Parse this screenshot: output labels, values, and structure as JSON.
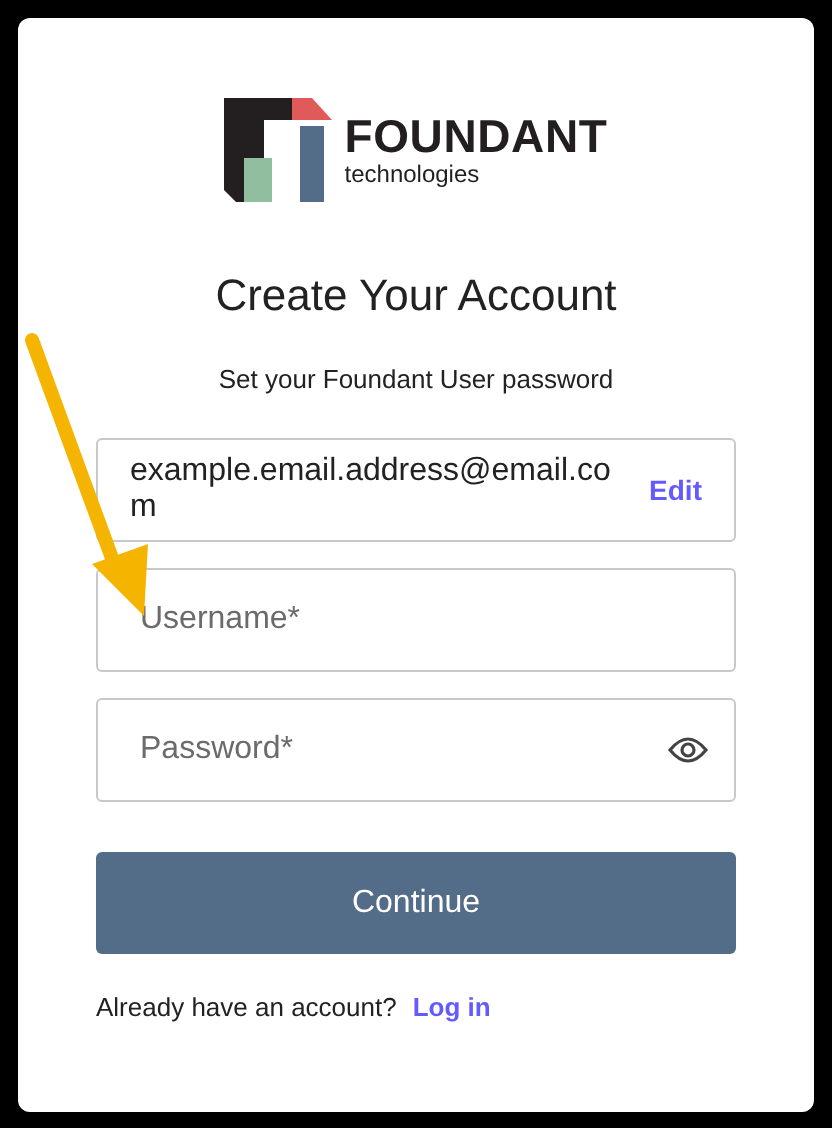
{
  "logo": {
    "name": "FOUNDANT",
    "tagline": "technologies"
  },
  "title": "Create Your Account",
  "subtitle": "Set your Foundant User password",
  "email": {
    "value": "example.email.address@email.com",
    "action": "Edit"
  },
  "fields": [
    {
      "kind": "text",
      "placeholder": "Username*"
    },
    {
      "kind": "password",
      "placeholder": "Password*"
    }
  ],
  "primary_button": "Continue",
  "footer": {
    "text": "Already have an account?",
    "link": "Log in"
  }
}
